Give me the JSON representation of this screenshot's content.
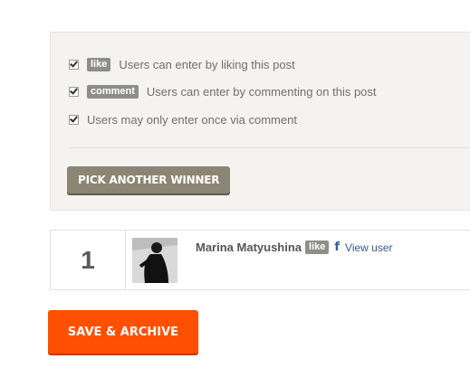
{
  "options": [
    {
      "badge": "like",
      "text": "Users can enter by liking this post",
      "checked": true
    },
    {
      "badge": "comment",
      "text": "Users can enter by commenting on this post",
      "checked": true
    },
    {
      "badge": "",
      "text": "Users may only enter once via comment",
      "checked": true
    }
  ],
  "pick_button": "PICK ANOTHER WINNER",
  "winner": {
    "rank": "1",
    "name": "Marina Matyushina",
    "badge": "like",
    "fb_glyph": "f",
    "view_user": "View user",
    "avatar_icon": "user-photo"
  },
  "save_button": "SAVE & ARCHIVE",
  "colors": {
    "panel_bg": "#f4f3f0",
    "badge_bg": "#8d8d8a",
    "pick_button_bg": "#8b8673",
    "save_button_bg": "#ff4f00",
    "facebook_blue": "#3b5998"
  }
}
